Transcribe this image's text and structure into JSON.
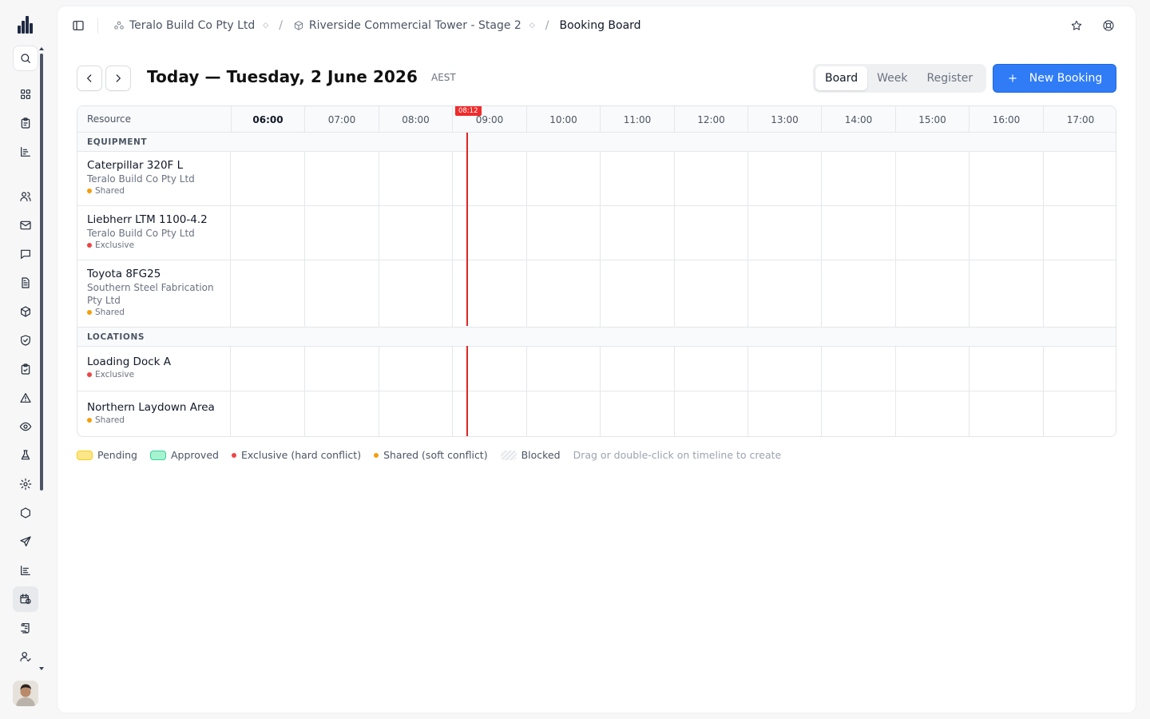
{
  "breadcrumb": {
    "org": "Teralo Build Co Pty Ltd",
    "project": "Riverside Commercial Tower - Stage 2",
    "page": "Booking Board"
  },
  "toolbar": {
    "title": "Today — Tuesday, 2 June 2026",
    "timezone": "AEST",
    "views": [
      "Board",
      "Week",
      "Register"
    ],
    "active_view": "Board",
    "new_booking_label": "New Booking"
  },
  "board": {
    "resource_header": "Resource",
    "hours": [
      "06:00",
      "07:00",
      "08:00",
      "09:00",
      "10:00",
      "11:00",
      "12:00",
      "13:00",
      "14:00",
      "15:00",
      "16:00",
      "17:00"
    ],
    "current_hour": "06:00",
    "now_marker": "08:12",
    "groups": [
      {
        "title": "EQUIPMENT",
        "rows": [
          {
            "name": "Caterpillar 320F L",
            "owner": "Teralo Build Co Pty Ltd",
            "mode": "Shared"
          },
          {
            "name": "Liebherr LTM 1100-4.2",
            "owner": "Teralo Build Co Pty Ltd",
            "mode": "Exclusive"
          },
          {
            "name": "Toyota 8FG25",
            "owner": "Southern Steel Fabrication Pty Ltd",
            "mode": "Shared"
          }
        ]
      },
      {
        "title": "LOCATIONS",
        "rows": [
          {
            "name": "Loading Dock A",
            "owner": "",
            "mode": "Exclusive"
          },
          {
            "name": "Northern Laydown Area",
            "owner": "",
            "mode": "Shared"
          }
        ]
      }
    ]
  },
  "legend": {
    "pending": "Pending",
    "approved": "Approved",
    "exclusive": "Exclusive (hard conflict)",
    "shared": "Shared (soft conflict)",
    "blocked": "Blocked",
    "hint": "Drag or double-click on timeline to create"
  },
  "colors": {
    "accent": "#2f7cf6",
    "exclusive": "#ef4444",
    "shared": "#f59e0b",
    "pending": "#fde68a",
    "approved": "#a7f3d0",
    "now": "#dc2626"
  }
}
